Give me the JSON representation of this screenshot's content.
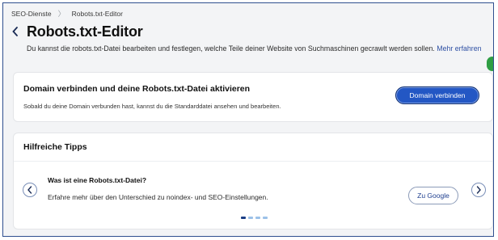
{
  "breadcrumb": {
    "items": [
      "SEO-Dienste",
      "Robots.txt-Editor"
    ],
    "separator": "〉"
  },
  "header": {
    "title": "Robots.txt-Editor",
    "subtitle": "Du kannst die robots.txt-Datei bearbeiten und festlegen, welche Teile deiner Website von Suchmaschinen gecrawlt werden sollen.",
    "learn_more": "Mehr erfahren"
  },
  "domain_card": {
    "title": "Domain verbinden und deine Robots.txt-Datei aktivieren",
    "description": "Sobald du deine Domain verbunden hast, kannst du die Standarddatei ansehen und bearbeiten.",
    "button_label": "Domain verbinden"
  },
  "tips_card": {
    "title": "Hilfreiche Tipps",
    "tip": {
      "title": "Was ist eine Robots.txt-Datei?",
      "description": "Erfahre mehr über den Unterschied zu noindex- und SEO-Einstellungen.",
      "button_label": "Zu Google"
    },
    "pagination": {
      "total": 4,
      "active": 1
    }
  },
  "colors": {
    "primary": "#2357c4",
    "link": "#2d4fa3",
    "dot_active": "#1b3f86",
    "dot_inactive": "#9cc1e8",
    "badge": "#2f9e44"
  },
  "icons": {
    "back": "chevron-left-icon",
    "prev": "chevron-left-icon",
    "next": "chevron-right-icon"
  }
}
